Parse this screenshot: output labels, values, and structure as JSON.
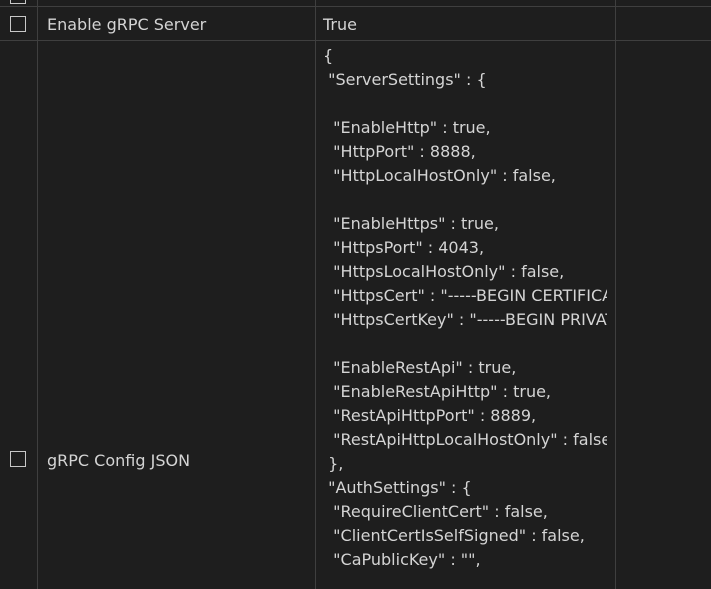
{
  "rows": [
    {
      "name": "Enable gRPC Server",
      "value": "True"
    },
    {
      "name": "gRPC Config JSON",
      "value_lines": [
        "{",
        " \"ServerSettings\" : {",
        "",
        "  \"EnableHttp\" : true,",
        "  \"HttpPort\" : 8888,",
        "  \"HttpLocalHostOnly\" : false,",
        "",
        "  \"EnableHttps\" : true,",
        "  \"HttpsPort\" : 4043,",
        "  \"HttpsLocalHostOnly\" : false,",
        "  \"HttpsCert\" : \"-----BEGIN CERTIFICATE",
        "  \"HttpsCertKey\" : \"-----BEGIN PRIVATE",
        "",
        "  \"EnableRestApi\" : true,",
        "  \"EnableRestApiHttp\" : true,",
        "  \"RestApiHttpPort\" : 8889,",
        "  \"RestApiHttpLocalHostOnly\" : false",
        " },",
        " \"AuthSettings\" : {",
        "  \"RequireClientCert\" : false,",
        "  \"ClientCertIsSelfSigned\" : false,",
        "  \"CaPublicKey\" : \"\","
      ]
    }
  ]
}
